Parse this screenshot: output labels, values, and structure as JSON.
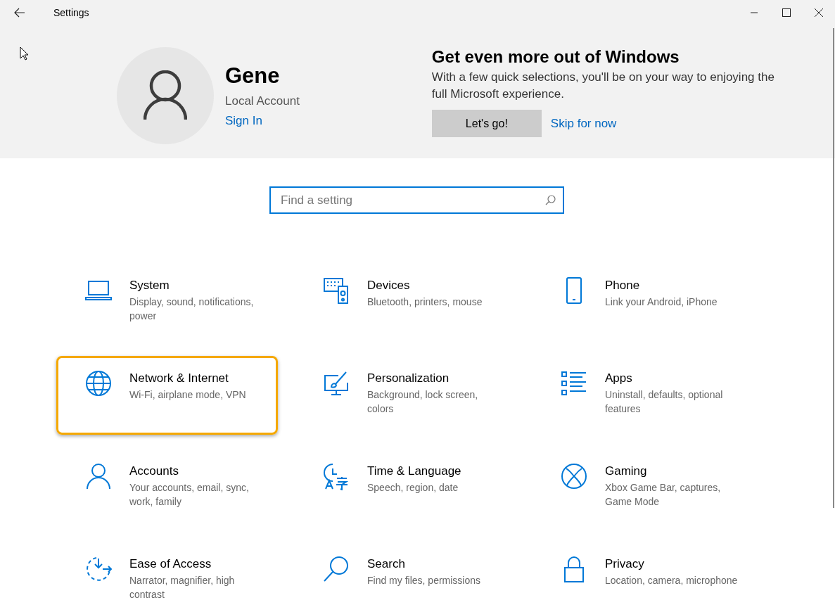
{
  "window": {
    "title": "Settings"
  },
  "account": {
    "name": "Gene",
    "type": "Local Account",
    "sign_in": "Sign In"
  },
  "promo": {
    "title": "Get even more out of Windows",
    "text": "With a few quick selections, you'll be on your way to enjoying the full Microsoft experience.",
    "primary_button": "Let's go!",
    "secondary_link": "Skip for now"
  },
  "search": {
    "placeholder": "Find a setting"
  },
  "categories": [
    {
      "title": "System",
      "description": "Display, sound, notifications, power",
      "highlighted": false
    },
    {
      "title": "Devices",
      "description": "Bluetooth, printers, mouse",
      "highlighted": false
    },
    {
      "title": "Phone",
      "description": "Link your Android, iPhone",
      "highlighted": false
    },
    {
      "title": "Network & Internet",
      "description": "Wi-Fi, airplane mode, VPN",
      "highlighted": true
    },
    {
      "title": "Personalization",
      "description": "Background, lock screen, colors",
      "highlighted": false
    },
    {
      "title": "Apps",
      "description": "Uninstall, defaults, optional features",
      "highlighted": false
    },
    {
      "title": "Accounts",
      "description": "Your accounts, email, sync, work, family",
      "highlighted": false
    },
    {
      "title": "Time & Language",
      "description": "Speech, region, date",
      "highlighted": false
    },
    {
      "title": "Gaming",
      "description": "Xbox Game Bar, captures, Game Mode",
      "highlighted": false
    },
    {
      "title": "Ease of Access",
      "description": "Narrator, magnifier, high contrast",
      "highlighted": false
    },
    {
      "title": "Search",
      "description": "Find my files, permissions",
      "highlighted": false
    },
    {
      "title": "Privacy",
      "description": "Location, camera, microphone",
      "highlighted": false
    }
  ]
}
